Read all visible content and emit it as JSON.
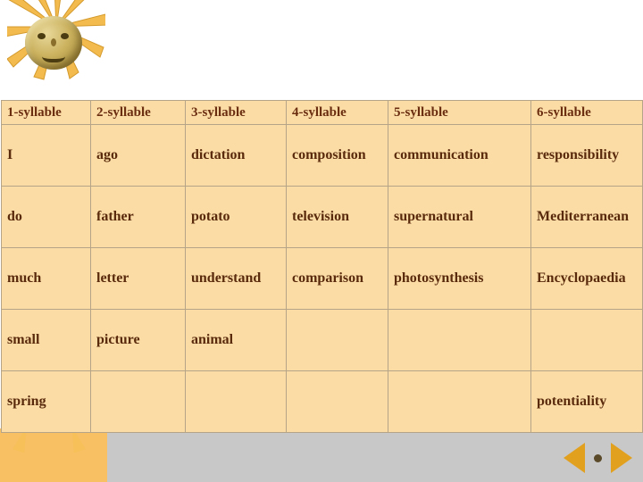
{
  "slide": {
    "decor": {
      "sun_icon": "sun-face-icon",
      "left_arrow": "nav-previous-arrow-icon",
      "right_arrow": "nav-next-arrow-icon",
      "dot": "nav-dot-icon"
    },
    "table": {
      "headers": [
        "1-syllable",
        "2-syllable",
        "3-syllable",
        "4-syllable",
        "5-syllable",
        "6-syllable"
      ],
      "rows": [
        [
          "I",
          "ago",
          "dictation",
          "composition",
          "communication",
          "responsibility"
        ],
        [
          "do",
          "father",
          "potato",
          "television",
          "supernatural",
          "Mediterranean"
        ],
        [
          "much",
          "letter",
          "understand",
          "comparison",
          "photosynthesis",
          "Encyclopaedia"
        ],
        [
          "small",
          "picture",
          "animal",
          "",
          "",
          ""
        ],
        [
          "spring",
          "",
          "",
          "",
          "",
          "potentiality"
        ]
      ]
    }
  }
}
